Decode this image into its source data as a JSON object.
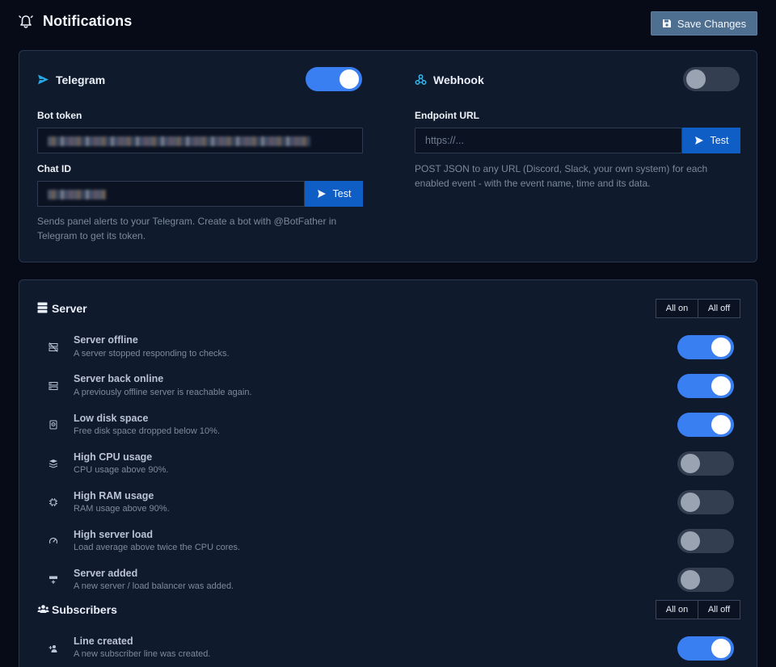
{
  "header": {
    "title": "Notifications",
    "save_label": "Save Changes"
  },
  "telegram": {
    "title": "Telegram",
    "enabled": true,
    "bot_token_label": "Bot token",
    "chat_id_label": "Chat ID",
    "test_label": "Test",
    "help": "Sends panel alerts to your Telegram. Create a bot with @BotFather in Telegram to get its token."
  },
  "webhook": {
    "title": "Webhook",
    "enabled": false,
    "endpoint_label": "Endpoint URL",
    "endpoint_placeholder": "https://...",
    "test_label": "Test",
    "help": "POST JSON to any URL (Discord, Slack, your own system) for each enabled event - with the event name, time and its data."
  },
  "groups": {
    "server": {
      "title": "Server",
      "all_on": "All on",
      "all_off": "All off",
      "events": [
        {
          "title": "Server offline",
          "desc": "A server stopped responding to checks.",
          "icon": "server-off-icon",
          "enabled": true
        },
        {
          "title": "Server back online",
          "desc": "A previously offline server is reachable again.",
          "icon": "server-icon",
          "enabled": true
        },
        {
          "title": "Low disk space",
          "desc": "Free disk space dropped below 10%.",
          "icon": "hdd-icon",
          "enabled": true
        },
        {
          "title": "High CPU usage",
          "desc": "CPU usage above 90%.",
          "icon": "layers-icon",
          "enabled": false
        },
        {
          "title": "High RAM usage",
          "desc": "RAM usage above 90%.",
          "icon": "chip-icon",
          "enabled": false
        },
        {
          "title": "High server load",
          "desc": "Load average above twice the CPU cores.",
          "icon": "gauge-icon",
          "enabled": false
        },
        {
          "title": "Server added",
          "desc": "A new server / load balancer was added.",
          "icon": "server-plus-icon",
          "enabled": false
        }
      ]
    },
    "subscribers": {
      "title": "Subscribers",
      "all_on": "All on",
      "all_off": "All off",
      "events": [
        {
          "title": "Line created",
          "desc": "A new subscriber line was created.",
          "icon": "user-plus-icon",
          "enabled": true
        }
      ]
    }
  },
  "colors": {
    "accent": "#3a7ff2",
    "button_blue": "#0f5ec6",
    "telegram_icon": "#29a8e6",
    "webhook_icon": "#39b3e8"
  }
}
